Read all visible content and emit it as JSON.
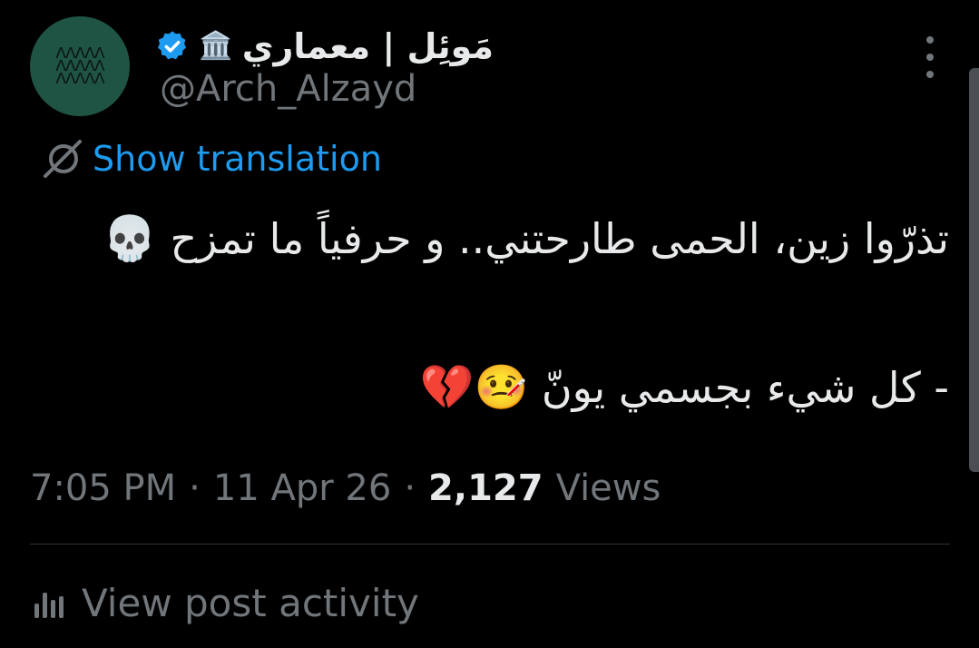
{
  "author": {
    "display_name": "مَوئِل | معماري",
    "building_emoji": "🏛️",
    "handle": "@Arch_Alzayd",
    "avatar_mark": "ᐱᐱᐱᐱᐱ",
    "verified": true
  },
  "translation": {
    "label": "Show translation"
  },
  "tweet": {
    "line1_text": "تذرّوا زين، الحمى طارحتني.. و حرفياً ما تمزح",
    "line1_emoji": "💀",
    "line2_text": "- كل شيء بجسمي يونّ",
    "line2_emojis": "🤒💔"
  },
  "meta": {
    "time": "7:05 PM",
    "sep1": "·",
    "date": "11 Apr 26",
    "sep2": "·",
    "views_count": "2,127",
    "views_label": "Views"
  },
  "actions": {
    "view_activity": "View post activity"
  },
  "icons": {
    "verified": "verified-badge-icon",
    "more": "more-options-icon",
    "translate": "globe-translate-icon",
    "activity": "bar-chart-icon"
  },
  "colors": {
    "background": "#000000",
    "accent": "#1d9bf0",
    "text_primary": "#e7e9ea",
    "text_secondary": "#71767b",
    "avatar_bg": "#1f5444"
  }
}
